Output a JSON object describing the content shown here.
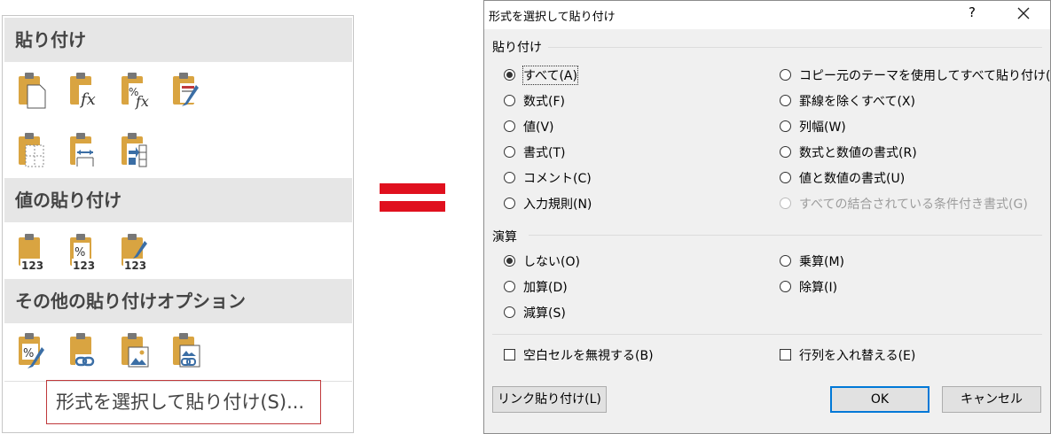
{
  "menu": {
    "sections": [
      {
        "title": "貼り付け"
      },
      {
        "title": "値の貼り付け"
      },
      {
        "title": "その他の貼り付けオプション"
      }
    ],
    "icons": {
      "paste": [
        "paste-icon",
        "paste-formulas-icon",
        "paste-formulas-number-format-icon",
        "paste-keep-source-formatting-icon",
        "paste-no-borders-icon",
        "paste-keep-column-widths-icon",
        "paste-transpose-icon"
      ],
      "values": [
        "paste-values-icon",
        "paste-values-number-format-icon",
        "paste-values-source-formatting-icon"
      ],
      "other": [
        "paste-formatting-icon",
        "paste-link-icon",
        "paste-picture-icon",
        "paste-linked-picture-icon"
      ]
    },
    "special_label": "形式を選択して貼り付け(S)..."
  },
  "separator_symbol": "＝",
  "dialog": {
    "title": "形式を選択して貼り付け",
    "help": "?",
    "paste_group": "貼り付け",
    "paste_options": [
      {
        "label": "すべて(A)",
        "selected": true
      },
      {
        "label": "数式(F)"
      },
      {
        "label": "値(V)"
      },
      {
        "label": "書式(T)"
      },
      {
        "label": "コメント(C)"
      },
      {
        "label": "入力規則(N)"
      },
      {
        "label": "コピー元のテーマを使用してすべて貼り付け(H)"
      },
      {
        "label": "罫線を除くすべて(X)"
      },
      {
        "label": "列幅(W)"
      },
      {
        "label": "数式と数値の書式(R)"
      },
      {
        "label": "値と数値の書式(U)"
      },
      {
        "label": "すべての結合されている条件付き書式(G)",
        "disabled": true
      }
    ],
    "operation_group": "演算",
    "operation_options": [
      {
        "label": "しない(O)",
        "selected": true
      },
      {
        "label": "加算(D)"
      },
      {
        "label": "減算(S)"
      },
      {
        "label": "乗算(M)"
      },
      {
        "label": "除算(I)"
      }
    ],
    "skip_blanks": "空白セルを無視する(B)",
    "transpose": "行列を入れ替える(E)",
    "paste_link_button": "リンク貼り付け(L)",
    "ok_button": "OK",
    "cancel_button": "キャンセル"
  },
  "colors": {
    "accent": "#0078d7",
    "equals": "#e0101e",
    "highlight_border": "#c0393b",
    "clipboard": "#d9a441"
  }
}
